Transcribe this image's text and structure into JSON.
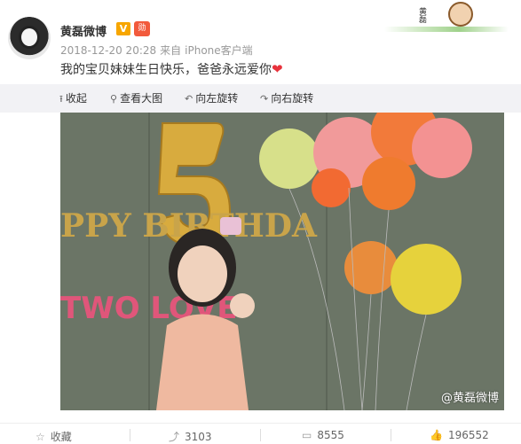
{
  "post": {
    "username": "黄磊微博",
    "vip_badge": "V",
    "medal_badge": "勋",
    "timestamp": "2018-12-20 20:28",
    "source_prefix": "来自",
    "source": "iPhone客户端",
    "text": "我的宝贝妹妹生日快乐，爸爸永远爱你",
    "heart": "❤",
    "card_sign": "黄磊"
  },
  "toolbar": {
    "collapse": "收起",
    "view_full": "查看大图",
    "rotate_left": "向左旋转",
    "rotate_right": "向右旋转"
  },
  "photo": {
    "watermark": "@黄磊微博",
    "banner_top": "PPY BIRTHDA",
    "banner_bottom": "TWO LOVE",
    "balloon_number": "5"
  },
  "footer": {
    "favorite": "收藏",
    "repost_count": "3103",
    "comment_count": "8555",
    "like_count": "196552"
  },
  "colors": {
    "accent": "#f7a600",
    "heart": "#e8323c",
    "toolbar_bg": "#f2f2f5"
  }
}
